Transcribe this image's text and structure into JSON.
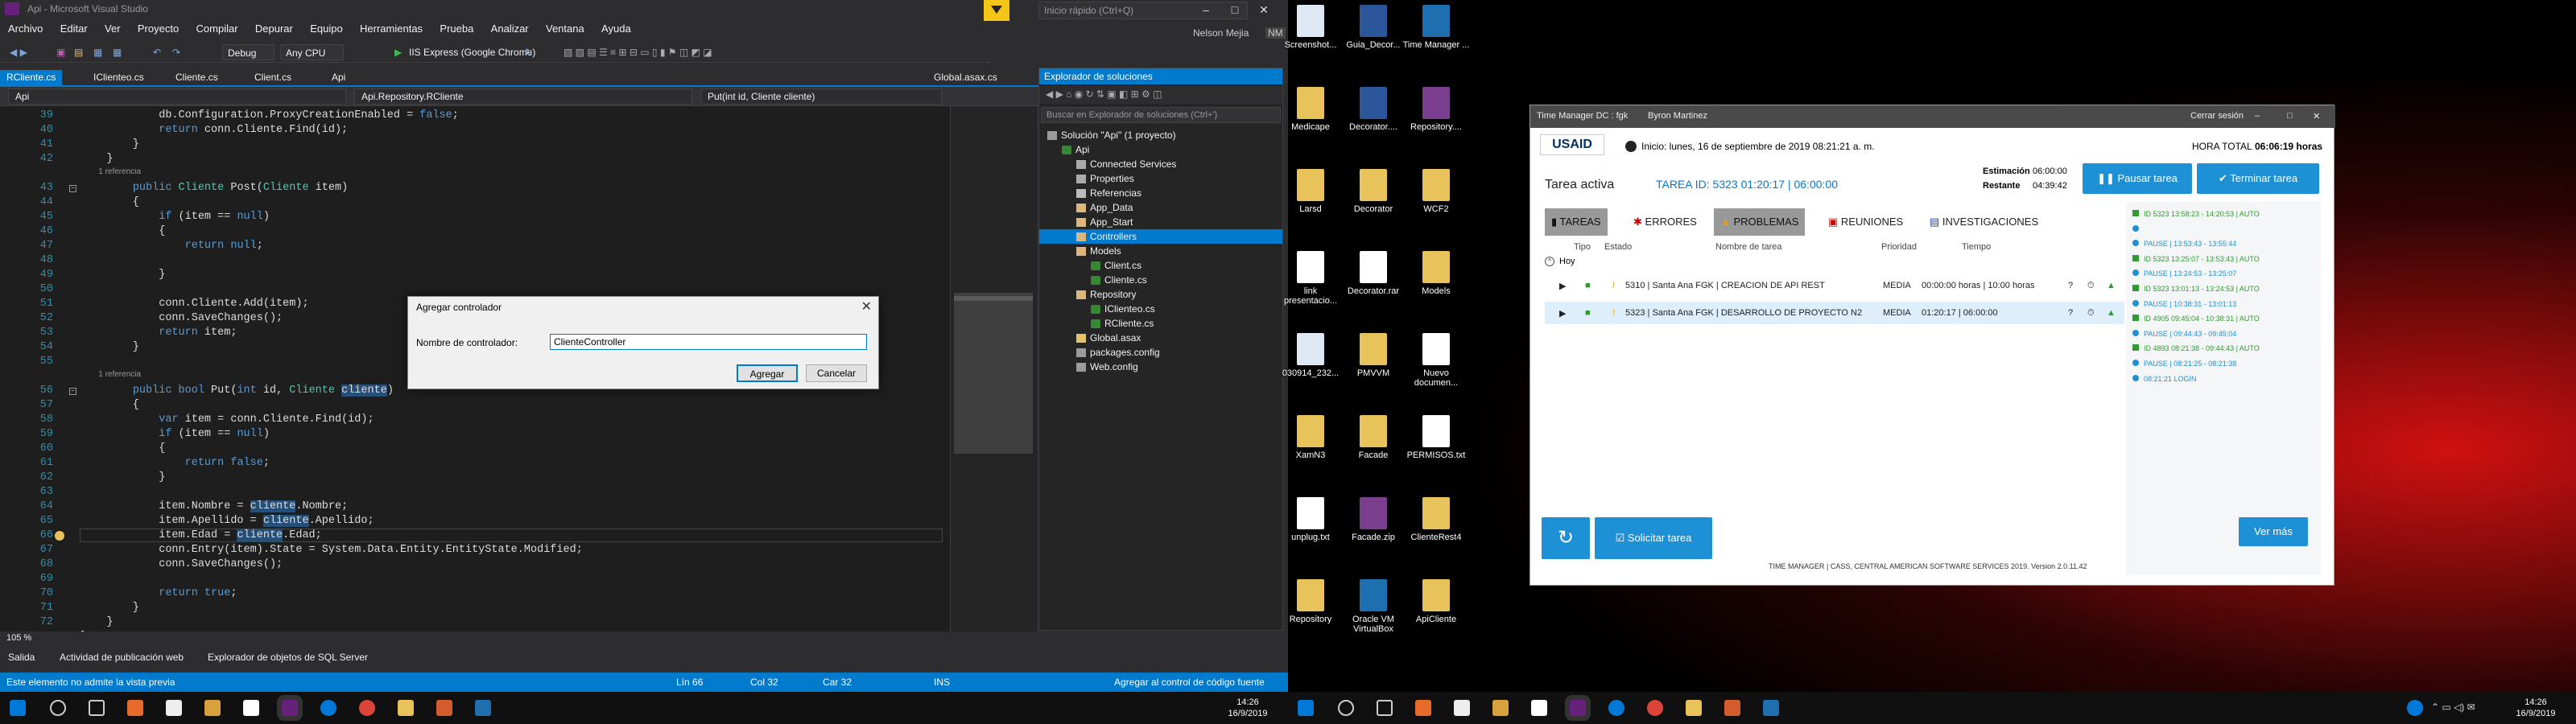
{
  "vs": {
    "title": "Api - Microsoft Visual Studio",
    "menu": [
      "Archivo",
      "Editar",
      "Ver",
      "Proyecto",
      "Compilar",
      "Depurar",
      "Equipo",
      "Herramientas",
      "Prueba",
      "Analizar",
      "Ventana",
      "Ayuda"
    ],
    "quick_launch": "Inicio rápido (Ctrl+Q)",
    "user": "Nelson Mejia",
    "user_initials": "NM",
    "toolbar": {
      "config": "Debug",
      "platform": "Any CPU",
      "run": "IIS Express (Google Chrome)"
    },
    "tabs": [
      "RCliente.cs",
      "IClienteo.cs",
      "Cliente.cs",
      "Client.cs",
      "Api",
      "Global.asax.cs"
    ],
    "nav": {
      "project": "Api",
      "class": "Api.Repository.RCliente",
      "member": "Put(int id, Cliente cliente)"
    },
    "zoom": "105 %",
    "bottom_tabs": [
      "Salida",
      "Actividad de publicación web",
      "Explorador de objetos de SQL Server"
    ],
    "status": {
      "message": "Este elemento no admite la vista previa",
      "line": "Lín 66",
      "col": "Col 32",
      "car": "Car 32",
      "ins": "INS",
      "source_control": "Agregar al control de código fuente"
    }
  },
  "code_lines": [
    {
      "n": "39",
      "t": "            db.Configuration.ProxyCreationEnabled = false;"
    },
    {
      "n": "40",
      "t": "            return conn.Cliente.Find(id);"
    },
    {
      "n": "41",
      "t": "        }"
    },
    {
      "n": "42",
      "t": "    }"
    },
    {
      "n": "",
      "t": "        1 referencia"
    },
    {
      "n": "43",
      "t": "        public Cliente Post(Cliente item)"
    },
    {
      "n": "44",
      "t": "        {"
    },
    {
      "n": "45",
      "t": "            if (item == null)"
    },
    {
      "n": "46",
      "t": "            {"
    },
    {
      "n": "47",
      "t": "                return null;"
    },
    {
      "n": "48",
      "t": ""
    },
    {
      "n": "49",
      "t": "            }"
    },
    {
      "n": "50",
      "t": ""
    },
    {
      "n": "51",
      "t": "            conn.Cliente.Add(item);"
    },
    {
      "n": "52",
      "t": "            conn.SaveChanges();"
    },
    {
      "n": "53",
      "t": "            return item;"
    },
    {
      "n": "54",
      "t": "        }"
    },
    {
      "n": "55",
      "t": ""
    },
    {
      "n": "",
      "t": "        1 referencia"
    },
    {
      "n": "56",
      "t": "        public bool Put(int id, Cliente cliente)"
    },
    {
      "n": "57",
      "t": "        {"
    },
    {
      "n": "58",
      "t": "            var item = conn.Cliente.Find(id);"
    },
    {
      "n": "59",
      "t": "            if (item == null)"
    },
    {
      "n": "60",
      "t": "            {"
    },
    {
      "n": "61",
      "t": "                return false;"
    },
    {
      "n": "62",
      "t": "            }"
    },
    {
      "n": "63",
      "t": ""
    },
    {
      "n": "64",
      "t": "            item.Nombre = cliente.Nombre;"
    },
    {
      "n": "65",
      "t": "            item.Apellido = cliente.Apellido;"
    },
    {
      "n": "66",
      "t": "            item.Edad = cliente.Edad;"
    },
    {
      "n": "67",
      "t": "            conn.Entry(item).State = System.Data.Entity.EntityState.Modified;"
    },
    {
      "n": "68",
      "t": "            conn.SaveChanges();"
    },
    {
      "n": "69",
      "t": ""
    },
    {
      "n": "70",
      "t": "            return true;"
    },
    {
      "n": "71",
      "t": "        }"
    },
    {
      "n": "72",
      "t": "    }"
    },
    {
      "n": "73",
      "t": "}"
    }
  ],
  "solution": {
    "header": "Explorador de soluciones",
    "search": "Buscar en Explorador de soluciones (Ctrl+')",
    "items": [
      {
        "label": "Solución \"Api\" (1 proyecto)",
        "indent": 0,
        "icon": "f-cfg"
      },
      {
        "label": "Api",
        "indent": 1,
        "icon": "f-cs"
      },
      {
        "label": "Connected Services",
        "indent": 2,
        "icon": "f-prop"
      },
      {
        "label": "Properties",
        "indent": 2,
        "icon": "f-prop"
      },
      {
        "label": "Referencias",
        "indent": 2,
        "icon": "f-ref"
      },
      {
        "label": "App_Data",
        "indent": 2,
        "icon": "f-folder"
      },
      {
        "label": "App_Start",
        "indent": 2,
        "icon": "f-folder"
      },
      {
        "label": "Controllers",
        "indent": 2,
        "icon": "f-folder",
        "selected": true
      },
      {
        "label": "Models",
        "indent": 2,
        "icon": "f-folder"
      },
      {
        "label": "Client.cs",
        "indent": 3,
        "icon": "f-cs"
      },
      {
        "label": "Cliente.cs",
        "indent": 3,
        "icon": "f-cs"
      },
      {
        "label": "Repository",
        "indent": 2,
        "icon": "f-folder"
      },
      {
        "label": "IClienteo.cs",
        "indent": 3,
        "icon": "f-cs"
      },
      {
        "label": "RCliente.cs",
        "indent": 3,
        "icon": "f-cs"
      },
      {
        "label": "Global.asax",
        "indent": 2,
        "icon": "f-asax"
      },
      {
        "label": "packages.config",
        "indent": 2,
        "icon": "f-cfg"
      },
      {
        "label": "Web.config",
        "indent": 2,
        "icon": "f-cfg"
      }
    ]
  },
  "dialog": {
    "title": "Agregar controlador",
    "label": "Nombre de controlador:",
    "value": "ClienteController",
    "ok": "Agregar",
    "cancel": "Cancelar"
  },
  "taskbar_left": {
    "time": "14:26",
    "date": "16/9/2019"
  },
  "taskbar_right": {
    "time": "14:26",
    "date": "16/9/2019"
  },
  "desktop_icons": [
    {
      "label": "Screenshot...",
      "color": "#dfe9f5"
    },
    {
      "label": "Guia_Decor...",
      "color": "#2b579a"
    },
    {
      "label": "Time Manager ...",
      "color": "#1e6fb0"
    },
    {
      "label": "Medicape",
      "color": "#e8c25a"
    },
    {
      "label": "Decorator....",
      "color": "#2b579a"
    },
    {
      "label": "Repository....",
      "color": "#7a3e8f"
    },
    {
      "label": "Larsd",
      "color": "#e8c25a"
    },
    {
      "label": "Decorator",
      "color": "#e8c25a"
    },
    {
      "label": "WCF2",
      "color": "#e8c25a"
    },
    {
      "label": "link presentacio...",
      "color": "#ffffff"
    },
    {
      "label": "Decorator.rar",
      "color": "#ffffff"
    },
    {
      "label": "Models",
      "color": "#e8c25a"
    },
    {
      "label": "030914_232...",
      "color": "#dfe9f5"
    },
    {
      "label": "PMVVM",
      "color": "#e8c25a"
    },
    {
      "label": "Nuevo documen...",
      "color": "#ffffff"
    },
    {
      "label": "XamN3",
      "color": "#e8c25a"
    },
    {
      "label": "Facade",
      "color": "#e8c25a"
    },
    {
      "label": "PERMISOS.txt",
      "color": "#ffffff"
    },
    {
      "label": "unplug.txt",
      "color": "#ffffff"
    },
    {
      "label": "Facade.zip",
      "color": "#7a3e8f"
    },
    {
      "label": "ClienteRest4",
      "color": "#e8c25a"
    },
    {
      "label": "Repository",
      "color": "#e8c25a"
    },
    {
      "label": "Oracle VM VirtualBox",
      "color": "#1e6fb0"
    },
    {
      "label": "ApiCliente",
      "color": "#e8c25a"
    }
  ],
  "tm": {
    "title": "Time Manager DC : fgk",
    "user": "Byron Martinez",
    "logout": "Cerrar sesión",
    "logo": "USAID",
    "start": "Inicio: lunes, 16 de septiembre de 2019 08:21:21 a. m.",
    "hora_total_label": "HORA TOTAL",
    "hora_total": "06:06:19 horas",
    "active_label": "Tarea activa",
    "task_info": "TAREA ID: 5323   01:20:17  |  06:00:00",
    "est_label": "Estimación",
    "est_val": "06:00:00",
    "rest_label": "Restante",
    "rest_val": "04:39:42",
    "btn_pause": "Pausar tarea",
    "btn_end": "Terminar tarea",
    "tabs": [
      "TAREAS",
      "ERRORES",
      "PROBLEMAS",
      "REUNIONES",
      "INVESTIGACIONES"
    ],
    "cols": [
      "Tipo",
      "Estado",
      "Nombre de tarea",
      "Prioridad",
      "Tiempo"
    ],
    "group": "Hoy",
    "rows": [
      {
        "name": "5310 | Santa Ana FGK | CREACION DE API REST",
        "prio": "MEDIA",
        "time": "00:00:00 horas | 10:00 horas"
      },
      {
        "name": "5323 | Santa Ana FGK | DESARROLLO DE PROYECTO N2",
        "prio": "MEDIA",
        "time": "01:20:17  |  06:00:00"
      }
    ],
    "log": [
      {
        "t": "ID 5323  13:58:23 - 14:20:53 | AUTO",
        "g": true
      },
      {
        "t": "",
        "g": false
      },
      {
        "t": "PAUSE | 13:53:43 - 13:55:44",
        "g": false
      },
      {
        "t": "ID 5323  13:25:07 - 13:53:43 | AUTO",
        "g": true
      },
      {
        "t": "PAUSE | 13:24:53 - 13:25:07",
        "g": false
      },
      {
        "t": "ID 5323  13:01:13 - 13:24:53 | AUTO",
        "g": true
      },
      {
        "t": "PAUSE | 10:38:31 - 13:01:13",
        "g": false
      },
      {
        "t": "ID 4905  09:45:04 - 10:38:31 | AUTO",
        "g": true
      },
      {
        "t": "PAUSE | 09:44:43 - 09:45:04",
        "g": false
      },
      {
        "t": "ID 4893  08:21:38 - 09:44:43 | AUTO",
        "g": true
      },
      {
        "t": "PAUSE | 08:21:25 - 08:21:38",
        "g": false
      },
      {
        "t": "08:21:21 LOGIN",
        "g": false
      }
    ],
    "refresh": "",
    "request": "Solicitar tarea",
    "more": "Ver más",
    "footer": "TIME MANAGER | CASS, CENTRAL AMERICAN SOFTWARE SERVICES 2019. Version 2.0.11.42"
  }
}
